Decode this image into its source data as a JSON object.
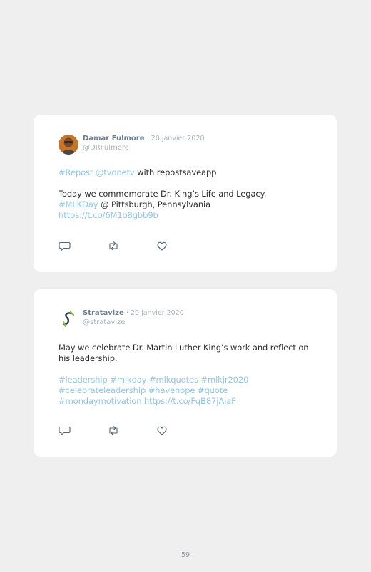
{
  "tweets": [
    {
      "author": "Damar Fulmore",
      "date": "· 20 janvier 2020",
      "handle": "@DRFulmore",
      "avatar_icon": "profile-photo",
      "line1": {
        "link1": "#Repost",
        "space": " ",
        "link2": "@tvonetv",
        "rest": " with repostsaveapp"
      },
      "line2": "Today we commemorate Dr. King’s Life and Legacy.",
      "line3": {
        "link": "#MLKDay",
        "rest": " @ Pittsburgh, Pennsylvania"
      },
      "line4": "https://t.co/6M1o8gbb9b"
    },
    {
      "author": "Stratavize",
      "date": "· 20 janvier 2020",
      "handle": "@stratavize",
      "avatar_icon": "stratavize-logo",
      "line1": "May we celebrate Dr. Martin Luther King’s work and reflect on his leadership.",
      "line2": "#leadership #mlkday #mlkquotes #mlkjr2020",
      "line3": "#celebrateleadership #havehope #quote",
      "line4": "#mondaymotivation https://t.co/FqB87jAjaF"
    }
  ],
  "actions": {
    "reply_icon": "reply-icon",
    "retweet_icon": "retweet-icon",
    "like_icon": "like-icon"
  },
  "colors": {
    "link": "#8fc6e6",
    "name": "#6d7f8e",
    "meta": "#a9b3bc",
    "background": "#efefef"
  },
  "page_number": "59"
}
